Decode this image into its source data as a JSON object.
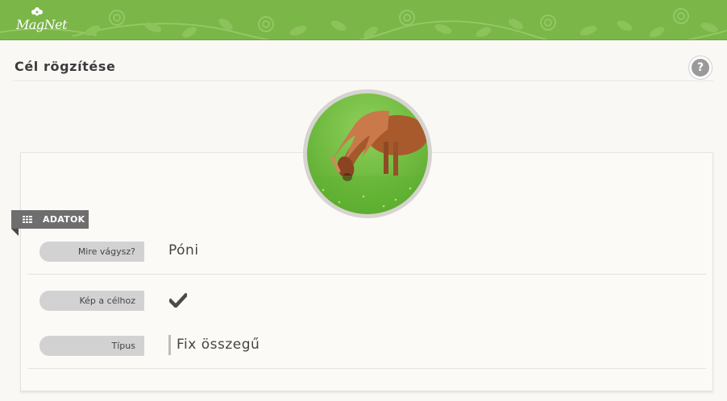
{
  "app": {
    "logo_text": "MagNet"
  },
  "page": {
    "title": "Cél rögzítése"
  },
  "help": {
    "icon": "question-icon",
    "label": "?"
  },
  "goal_image": {
    "subject": "pony-photo"
  },
  "section": {
    "label": "ADATOK",
    "icon": "table-icon"
  },
  "fields": [
    {
      "label": "Mire vágysz?",
      "value": "Póni"
    },
    {
      "label": "Kép a célhoz",
      "value_icon": "checkmark-icon"
    },
    {
      "label": "Típus",
      "value": "Fix összegű"
    }
  ],
  "colors": {
    "header_green": "#7ab648",
    "tag_gray": "#6e6e6e",
    "label_pill": "#d2d2d2"
  }
}
